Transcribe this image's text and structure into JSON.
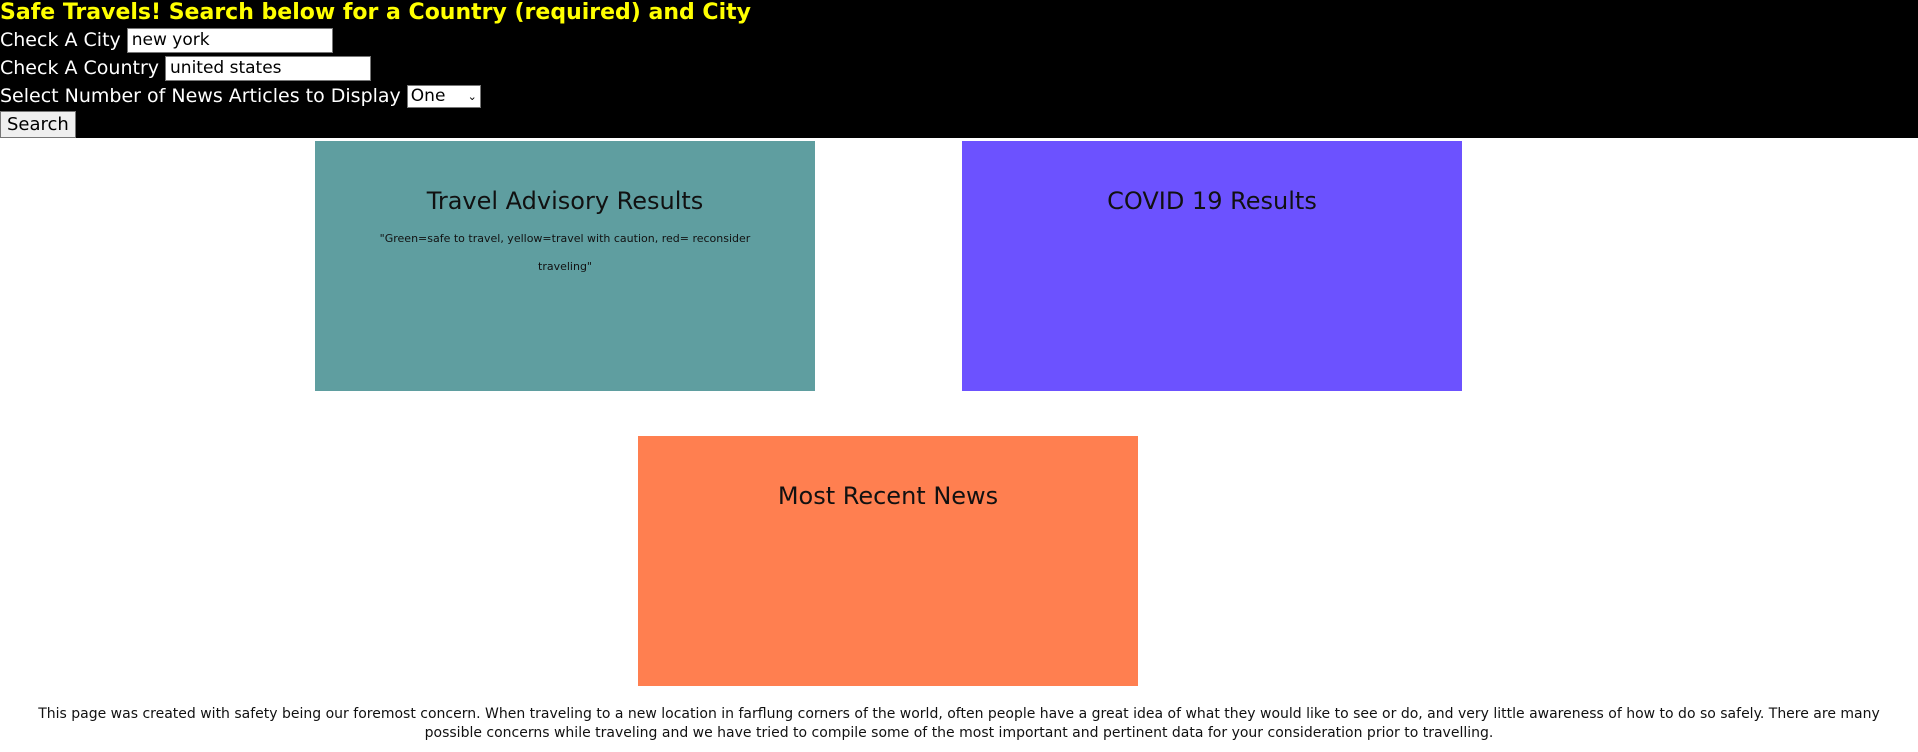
{
  "header": {
    "title": "Safe Travels! Search below for a Country (required) and City",
    "title_color": "#ffff00",
    "background": "#000000"
  },
  "form": {
    "city_label": "Check A City",
    "city_value": "new york",
    "country_label": "Check A Country",
    "country_value": "united states",
    "articles_label": "Select Number of News Articles to Display",
    "articles_selected": "One",
    "search_label": "Search"
  },
  "cards": {
    "advisory": {
      "title": "Travel Advisory Results",
      "note": "\"Green=safe to travel, yellow=travel with caution, red= reconsider traveling\"",
      "color": "#5f9ea0"
    },
    "covid": {
      "title": "COVID 19 Results",
      "color": "#6c52ff"
    },
    "news": {
      "title": "Most Recent News",
      "color": "#ff7f50"
    }
  },
  "footer": {
    "text": "This page was created with safety being our foremost concern. When traveling to a new location in farflung corners of the world, often people have a great idea of what they would like to see or do, and very little awareness of how to do so safely. There are many possible concerns while traveling and we have tried to compile some of the most important and pertinent data for your consideration prior to travelling."
  }
}
